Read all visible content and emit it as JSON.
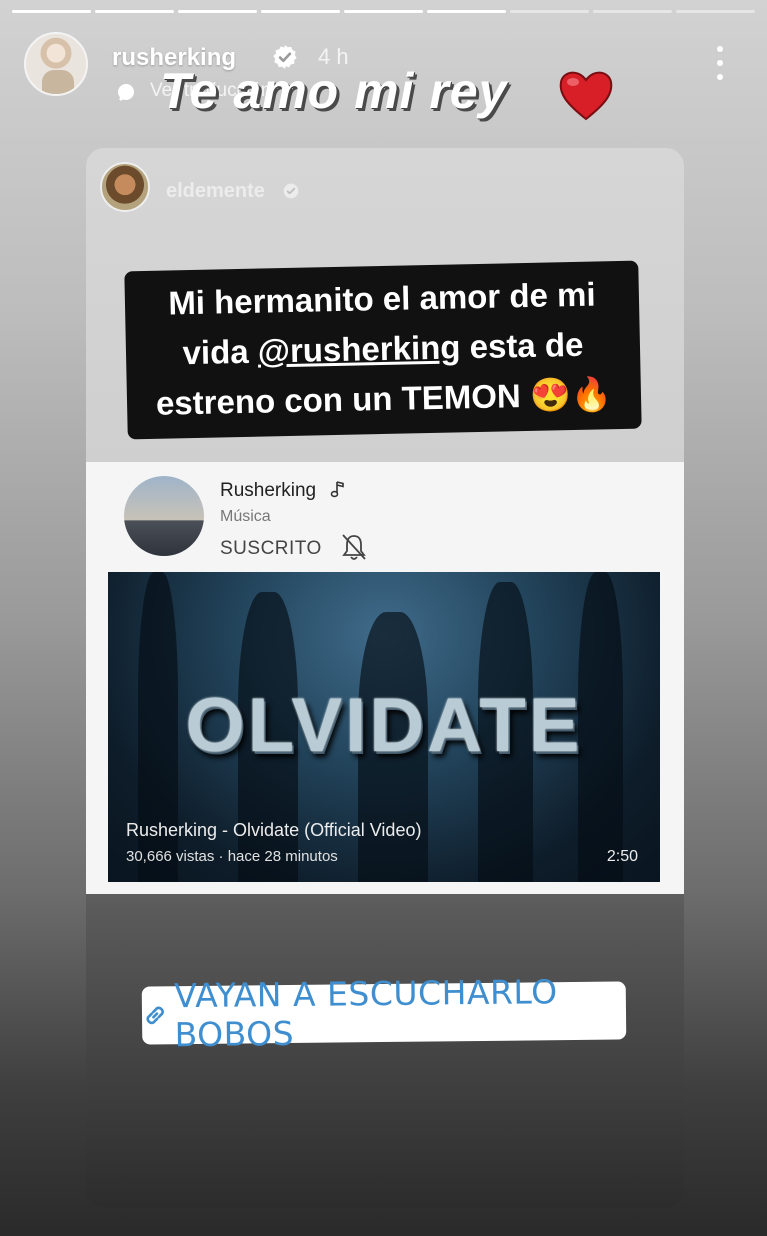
{
  "story": {
    "progress": {
      "segments": 9,
      "completed": 6
    },
    "user": {
      "username": "rusherking",
      "time": "4 h",
      "verified_icon": "verified-badge"
    },
    "translate_label": "Ver traducción",
    "caption": "Te amo mi rey",
    "caption_emoji": "red-heart",
    "more_icon": "three-dots-vertical"
  },
  "card": {
    "username": "eldemente",
    "verified_icon": "verified-badge",
    "quote": {
      "line1": "Mi hermanito el amor de mi",
      "line2_prefix": "vida ",
      "mention": "@rusherking",
      "line2_suffix": " esta de",
      "line3": "estreno con un TEMON 😍🔥"
    },
    "youtube": {
      "channel": "Rusherking",
      "category": "Música",
      "subscribe_label": "SUSCRITO",
      "thumbnail_title": "OLVIDATE",
      "video_title": "Rusherking - Olvidate (Official Video)",
      "meta": "30,666 vistas · hace 28 minutos",
      "duration": "2:50"
    },
    "link_sticker": {
      "label": "VAYAN A ESCUCHARLO BOBOS",
      "icon": "link-icon",
      "color": "#3f8fd0"
    }
  }
}
